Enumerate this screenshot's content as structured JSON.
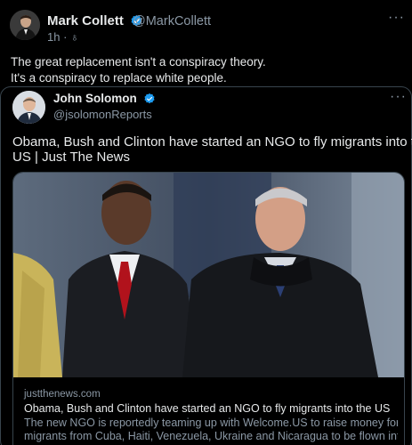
{
  "tweet": {
    "author_name": "Mark Collett",
    "author_handle": "@MarkCollett",
    "time": "1h · ♁",
    "text_line1": "The great replacement isn't a conspiracy theory.",
    "text_line2": "It's a conspiracy to replace white people.",
    "more_label": "···"
  },
  "quoted": {
    "author_name": "John Solomon",
    "author_handle": "@jsolomonReports",
    "text_line1": "Obama, Bush and Clinton have started an NGO to fly migrants into the",
    "text_line2": "US  | Just The News",
    "more_label": "···"
  },
  "link_card": {
    "domain": "justthenews.com",
    "title": "Obama, Bush and Clinton have started an NGO to fly migrants into the US",
    "desc_line1": "The new NGO is reportedly teaming up with Welcome.US to raise money for",
    "desc_line2": "migrants from Cuba, Haiti, Venezuela, Ukraine and Nicaragua to be flown into..."
  },
  "colors": {
    "background": "#000000",
    "verified_blue": "#1d9bf0",
    "secondary_text": "#8b98a5",
    "border": "#38444d"
  }
}
